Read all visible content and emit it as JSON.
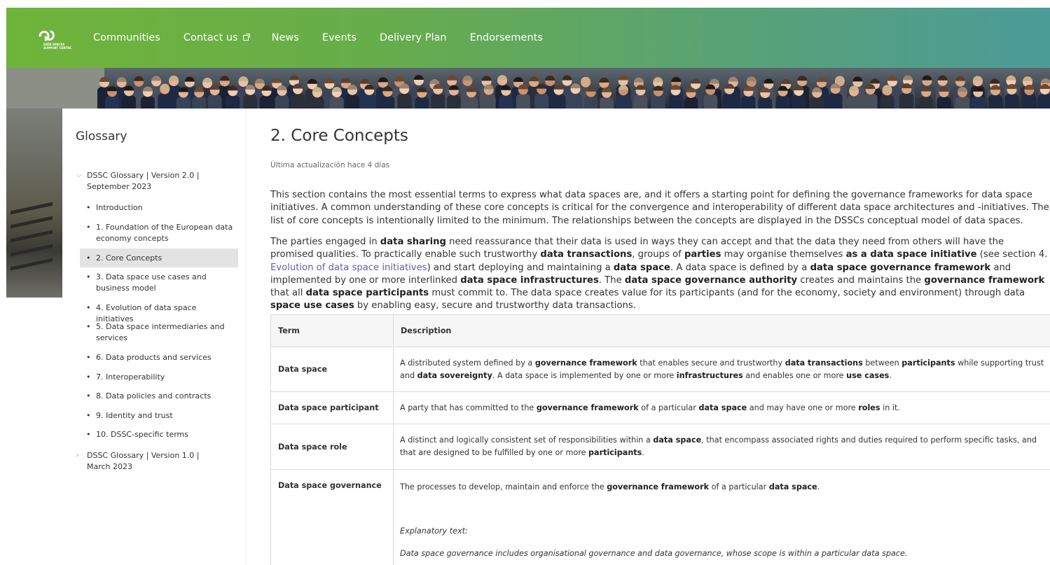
{
  "nav": {
    "items": [
      "Communities",
      "Contact us",
      "News",
      "Events",
      "Delivery Plan",
      "Endorsements"
    ],
    "logo_text": [
      "DATA SPACES",
      "SUPPORT CENTRE"
    ]
  },
  "sidebar": {
    "title": "Glossary",
    "root1": "DSSC Glossary | Version 2.0 | September 2023",
    "items": [
      "Introduction",
      "1. Foundation of the European data economy concepts",
      "2. Core Concepts",
      "3. Data space use cases and business model",
      "4. Evolution of data space initiatives",
      "5. Data space intermediaries and services",
      "6. Data products and services",
      "7. Interoperability",
      "8. Data policies and contracts",
      "9. Identity and trust",
      "10. DSSC-specific terms"
    ],
    "root2": "DSSC Glossary | Version 1.0 | March 2023"
  },
  "main": {
    "title": "2. Core Concepts",
    "updated": "Última actualización hace 4 días",
    "para1": "This section contains the most essential terms to express what data spaces are, and it offers a starting point for defining the governance frameworks for data space initiatives. A common understanding of these core concepts is critical for the convergence and interoperability of different data space architectures and -initiatives. The list of core concepts is intentionally limited to the minimum. The relationships between the concepts are displayed in the DSSCs conceptual model of data spaces.",
    "para2_link": "Evolution of data space initiatives",
    "table": {
      "headers": [
        "Term",
        "Description"
      ],
      "rows": [
        {
          "term": "Data space"
        },
        {
          "term": "Data space participant"
        },
        {
          "term": "Data space role"
        },
        {
          "term": "Data space governance",
          "explanatory_label": "Explanatory text:",
          "explanatory": "Data space governance includes organisational governance and data governance, whose scope is within a particular data space."
        }
      ]
    }
  },
  "colors": {
    "header_start": "#6fb43a",
    "header_end": "#4b9b98",
    "link": "#6a5aa8",
    "active_item": "#e3e3e3"
  }
}
